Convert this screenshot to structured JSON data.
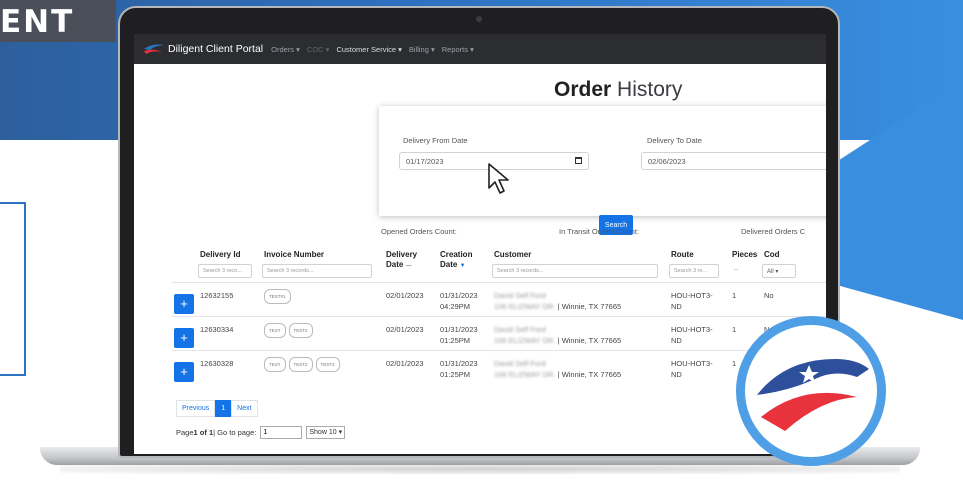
{
  "banner": {
    "title": "ENT"
  },
  "nav": {
    "brand": "Diligent Client Portal",
    "items": [
      {
        "label": "Orders ▾",
        "style": "dim2"
      },
      {
        "label": "COC ▾",
        "style": "dim"
      },
      {
        "label": "Customer Service ▾",
        "style": "bright"
      },
      {
        "label": "Billing ▾",
        "style": "dim2"
      },
      {
        "label": "Reports ▾",
        "style": "dim2"
      }
    ]
  },
  "page": {
    "title_bold": "Order",
    "title_rest": " History"
  },
  "filters": {
    "from_label": "Delivery From Date",
    "from_value": "01/17/2023",
    "to_label": "Delivery To Date",
    "to_value": "02/06/2023",
    "search_label": "Search"
  },
  "counts": {
    "opened": "Opened Orders Count:",
    "transit": "In Transit Orders Count:",
    "delivered": "Delivered Orders C"
  },
  "table": {
    "headers": {
      "delivery_id": "Delivery Id",
      "invoice": "Invoice Number",
      "delivery_date_1": "Delivery",
      "delivery_date_2": "Date",
      "creation_1": "Creation",
      "creation_2": "Date",
      "customer": "Customer",
      "route": "Route",
      "pieces": "Pieces",
      "cod": "Cod"
    },
    "filters": {
      "delivery_id": "Search 3 reco...",
      "invoice": "Search 3 records...",
      "customer": "Search 3 records...",
      "route": "Search 3 re...",
      "pieces": "--",
      "cod": "All"
    },
    "rows": [
      {
        "id": "12632155",
        "tags": [
          "TEST#1"
        ],
        "delivery_date": "02/01/2023",
        "creation_date": "01/31/2023",
        "creation_time": "04:29PM",
        "customer_name": "David Self Ford",
        "customer_addr": "106 ELIZWAY DR.",
        "customer_city": "| Winnie, TX 77665",
        "route_1": "HOU-HOT3-",
        "route_2": "ND",
        "pieces": "1",
        "cod": "No"
      },
      {
        "id": "12630334",
        "tags": [
          "TEST",
          "TEST2"
        ],
        "delivery_date": "02/01/2023",
        "creation_date": "01/31/2023",
        "creation_time": "01:25PM",
        "customer_name": "David Self Ford",
        "customer_addr": "106 ELIZWAY DR.",
        "customer_city": "| Winnie, TX 77665",
        "route_1": "HOU-HOT3-",
        "route_2": "ND",
        "pieces": "1",
        "cod": "No"
      },
      {
        "id": "12630328",
        "tags": [
          "TEST",
          "TEST2",
          "TEST3"
        ],
        "delivery_date": "02/01/2023",
        "creation_date": "01/31/2023",
        "creation_time": "01:25PM",
        "customer_name": "David Self Ford",
        "customer_addr": "106 ELIZWAY DR.",
        "customer_city": "| Winnie, TX 77665",
        "route_1": "HOU-HOT3-",
        "route_2": "ND",
        "pieces": "1",
        "cod": ""
      }
    ]
  },
  "pagination": {
    "previous": "Previous",
    "current": "1",
    "next": "Next",
    "page_prefix": "Page ",
    "page_of": "1 of 1",
    "goto": " | Go to page:",
    "goto_value": "1",
    "show": "Show 10"
  },
  "colors": {
    "accent": "#1473e6",
    "brand_blue": "#2e72c2",
    "brand_red": "#e8323c"
  }
}
